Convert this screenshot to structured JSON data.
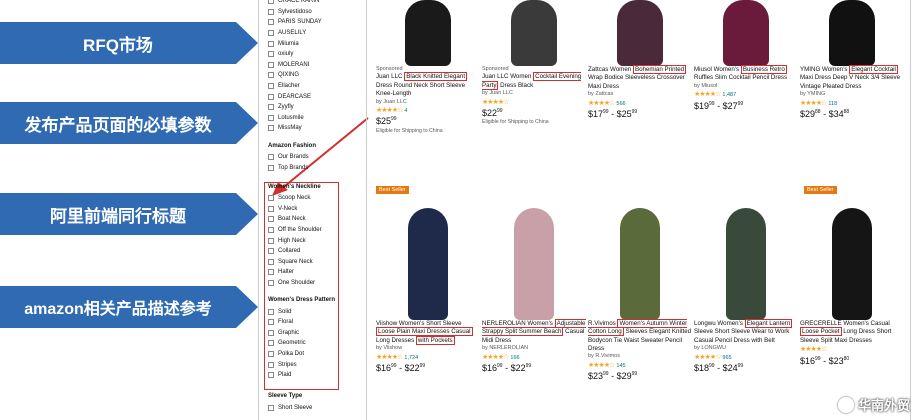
{
  "banners": [
    {
      "label": "RFQ市场"
    },
    {
      "label": "发布产品页面的必填参数"
    },
    {
      "label": "阿里前端同行标题"
    },
    {
      "label": "amazon相关产品描述参考"
    }
  ],
  "sidebar": {
    "brands_top": [
      "GRACE KARIN",
      "Sylvestidoso",
      "PARIS SUNDAY",
      "AUSELILY",
      "Milumia",
      "oxiuly",
      "MOLERANI",
      "QIXING",
      "Ellacher",
      "DEARCASE",
      "Zyyfly",
      "Lotusmile",
      "MissMay"
    ],
    "amazon_fashion_head": "Amazon Fashion",
    "amazon_fashion": [
      "Our Brands",
      "Top Brands"
    ],
    "neckline_head": "Women's Neckline",
    "neckline": [
      "Scoop Neck",
      "V-Neck",
      "Boat Neck",
      "Off the Shoulder",
      "High Neck",
      "Collared",
      "Square Neck",
      "Halter",
      "One Shoulder"
    ],
    "pattern_head": "Women's Dress Pattern",
    "pattern": [
      "Solid",
      "Floral",
      "Graphic",
      "Geometric",
      "Polka Dot",
      "Stripes",
      "Plaid"
    ],
    "sleeve_head": "Sleeve Type",
    "sleeve": [
      "Short Sleeve"
    ]
  },
  "products_row1": [
    {
      "sponsored": "Sponsored",
      "title_a": "Juan LLC ",
      "hl": "Black Knitted Elegant",
      "title_b": " Dress Round Neck Short Sleeve Knee-Length",
      "by": "by Juan LLC",
      "count": "4",
      "price_main": "$25",
      "price_cents": "99",
      "ship": "Eligible for Shipping to China",
      "color": "#1a1a1a"
    },
    {
      "sponsored": "Sponsored",
      "title_a": "Juan LLC Women ",
      "hl": "Cocktail Evening Party",
      "title_b": " Dress Black",
      "by": "by Juan LLC",
      "count": "",
      "price_main": "$22",
      "price_cents": "99",
      "ship": "Eligible for Shipping to China",
      "color": "#3a3a3a"
    },
    {
      "sponsored": "",
      "title_a": "Zattcas Women ",
      "hl": "Bohemian Printed",
      "title_b": " Wrap Bodice Sleeveless Crossover Maxi Dress",
      "by": "by Zattcas",
      "count": "566",
      "price_main": "$17",
      "price_cents": "99",
      "price2": " - $25",
      "price2_cents": "99",
      "ship": "",
      "color": "#4a2a3a"
    },
    {
      "sponsored": "",
      "title_a": "Miusol Women's ",
      "hl": "Business Retro",
      "title_b": " Ruffles Slim Cocktail Pencil Dress",
      "by": "by Miusol",
      "count": "1,487",
      "price_main": "$19",
      "price_cents": "99",
      "price2": " - $27",
      "price2_cents": "99",
      "ship": "",
      "color": "#6a1a3a"
    },
    {
      "sponsored": "",
      "title_a": "YMING Women's ",
      "hl": "Elegant Cocktail",
      "title_b": " Maxi Dress Deep V Neck 3/4 Sleeve Vintage Pleated Dress",
      "by": "by YMING",
      "count": "118",
      "price_main": "$29",
      "price_cents": "88",
      "price2": " - $34",
      "price2_cents": "88",
      "ship": "",
      "color": "#111111"
    }
  ],
  "products_row2": [
    {
      "best": "",
      "title_a": "Viishow Women's Short Sleeve ",
      "hl": "Loose Plain Maxi Dresses Casual",
      "title_b": " Long Dresses ",
      "hl2": "with Pockets",
      "by": "by Viishow",
      "count": "1,724",
      "price_main": "$16",
      "price_cents": "99",
      "price2": " - $22",
      "price2_cents": "99",
      "color": "#1f2a4a"
    },
    {
      "best": "",
      "title_a": "NERLEROLIAN Women's ",
      "hl": "Adjustable Strappy Split Summer Beach",
      "title_b": " Casual Midi Dress",
      "by": "by NERLEROLIAN",
      "count": "166",
      "price_main": "$16",
      "price_cents": "99",
      "price2": " - $22",
      "price2_cents": "99",
      "color": "#c9a0a8"
    },
    {
      "best": "",
      "title_a": "R.Vivimos ",
      "hl": "Women's Autumn Winter Cotton Long",
      "title_b": " Sleeves Elegant Knitted Bodycon Tie Waist Sweater Pencil Dress",
      "by": "by R.Vivimos",
      "count": "145",
      "price_main": "$23",
      "price_cents": "99",
      "price2": " - $29",
      "price2_cents": "99",
      "color": "#5a6a3a"
    },
    {
      "best": "",
      "title_a": "Longwu Women's ",
      "hl": "Elegant Lantern",
      "title_b": " Sleeve Short Sleeve Wear to Work Casual Pencil Dress with Belt",
      "by": "by LONGWU",
      "count": "965",
      "price_main": "$18",
      "price_cents": "99",
      "price2": " - $24",
      "price2_cents": "99",
      "color": "#3a4a3a"
    },
    {
      "best": "Best Seller",
      "title_a": "GRECERELLE Women's Casual ",
      "hl": "Loose Pocket",
      "title_b": " Long Dress Short Sleeve Split Maxi Dresses",
      "by": "",
      "count": "",
      "price_main": "$16",
      "price_cents": "99",
      "price2": " - $23",
      "price2_cents": "80",
      "color": "#151515"
    }
  ],
  "best_seller_left": "Best Seller",
  "watermark": "华南外贸"
}
